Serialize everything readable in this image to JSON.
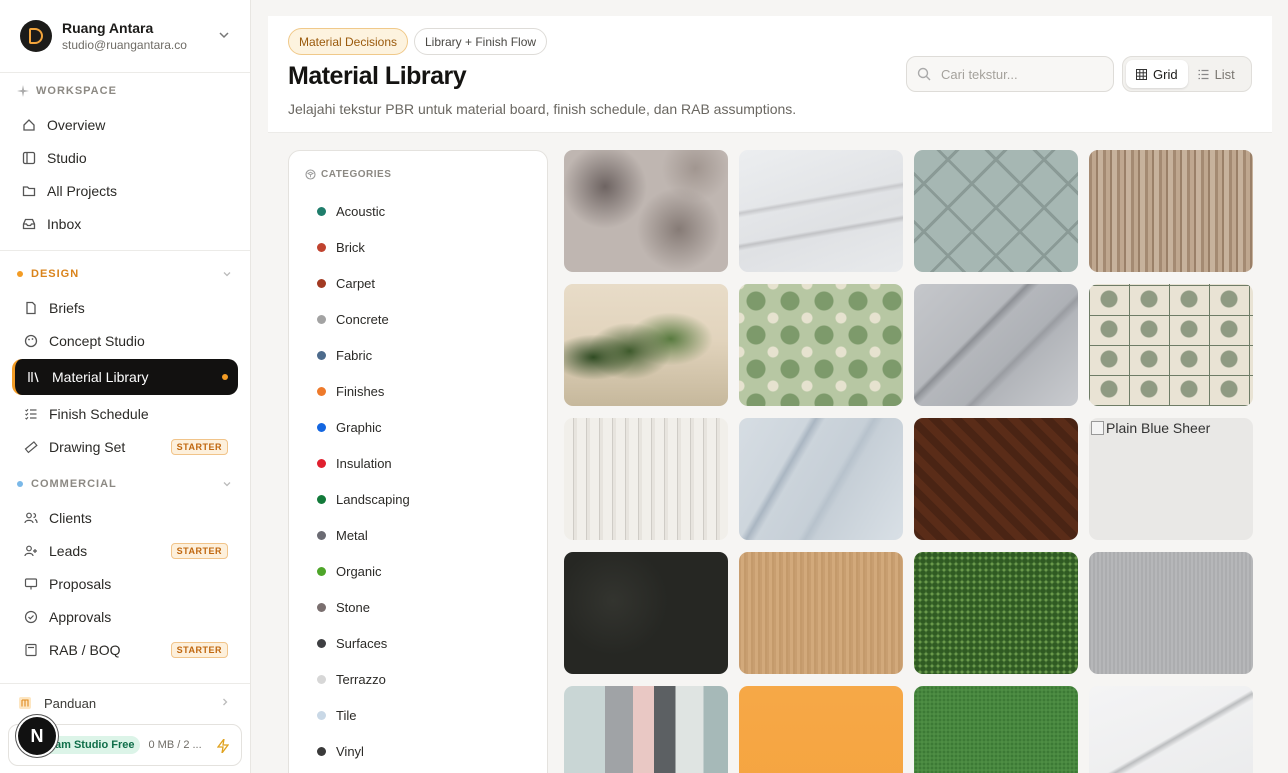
{
  "account": {
    "name": "Ruang Antara",
    "email": "studio@ruangantara.co"
  },
  "workspace": {
    "title": "WORKSPACE",
    "items": [
      {
        "label": "Overview",
        "icon": "home-icon"
      },
      {
        "label": "Studio",
        "icon": "layout-icon"
      },
      {
        "label": "All Projects",
        "icon": "folder-icon"
      },
      {
        "label": "Inbox",
        "icon": "inbox-icon"
      }
    ]
  },
  "design": {
    "title": "DESIGN",
    "accent": "#f39c25",
    "items": [
      {
        "label": "Briefs",
        "icon": "file-icon"
      },
      {
        "label": "Concept Studio",
        "icon": "palette-icon"
      },
      {
        "label": "Material Library",
        "icon": "library-icon",
        "active": true
      },
      {
        "label": "Finish Schedule",
        "icon": "checklist-icon"
      },
      {
        "label": "Drawing Set",
        "icon": "ruler-icon",
        "badge": "STARTER"
      }
    ]
  },
  "commercial": {
    "title": "COMMERCIAL",
    "accent": "#7ab8e8",
    "items": [
      {
        "label": "Clients",
        "icon": "users-icon"
      },
      {
        "label": "Leads",
        "icon": "user-plus-icon",
        "badge": "STARTER"
      },
      {
        "label": "Proposals",
        "icon": "monitor-icon"
      },
      {
        "label": "Approvals",
        "icon": "check-circle-icon"
      },
      {
        "label": "RAB / BOQ",
        "icon": "calculator-icon",
        "badge": "STARTER"
      }
    ]
  },
  "footer": {
    "guide_label": "Panduan",
    "plan_label": "Team Studio Free",
    "usage": "0 MB / 2 ...",
    "avatar_letter": "N"
  },
  "header": {
    "chip_primary": "Material Decisions",
    "chip_secondary": "Library + Finish Flow",
    "title": "Material Library",
    "subtitle": "Jelajahi tekstur PBR untuk material board, finish schedule, dan RAB assumptions.",
    "search_placeholder": "Cari tekstur...",
    "view_grid": "Grid",
    "view_list": "List",
    "active_view": "Grid"
  },
  "categories": {
    "title": "CATEGORIES",
    "items": [
      {
        "label": "Acoustic",
        "color": "#1f7d6b"
      },
      {
        "label": "Brick",
        "color": "#c0432f"
      },
      {
        "label": "Carpet",
        "color": "#a23a22"
      },
      {
        "label": "Concrete",
        "color": "#a3a3a3"
      },
      {
        "label": "Fabric",
        "color": "#4d6b8c"
      },
      {
        "label": "Finishes",
        "color": "#ee7a2b"
      },
      {
        "label": "Graphic",
        "color": "#1466e0"
      },
      {
        "label": "Insulation",
        "color": "#e0202f"
      },
      {
        "label": "Landscaping",
        "color": "#137a3a"
      },
      {
        "label": "Metal",
        "color": "#6b6b73"
      },
      {
        "label": "Organic",
        "color": "#4ea529"
      },
      {
        "label": "Stone",
        "color": "#7a6f6f"
      },
      {
        "label": "Surfaces",
        "color": "#3e3f42"
      },
      {
        "label": "Terrazzo",
        "color": "#d7d7d7"
      },
      {
        "label": "Tile",
        "color": "#c9d8e6"
      },
      {
        "label": "Vinyl",
        "color": "#3a3a3a"
      }
    ]
  },
  "materials": [
    {
      "name": "distressed-plaster-texture",
      "bg": "radial-gradient(circle at 25% 30%, #6e6462 0, transparent 28%), radial-gradient(circle at 70% 65%, #867b76 0, transparent 30%), radial-gradient(circle at 80% 15%, #a19690 0, transparent 20%), #bfb6b1"
    },
    {
      "name": "white-marble-texture",
      "bg": "linear-gradient(170deg, transparent 40%, #c8c9cc 42%, transparent 45%, transparent 62%, #c2c3c6 64%, transparent 67%), linear-gradient(160deg, #eceef0, #dfe1e4 60%, #e8eaec)"
    },
    {
      "name": "sage-herringbone-tile",
      "bg": "repeating-linear-gradient(45deg, #8a9a96 0 3px, transparent 3px 34px), repeating-linear-gradient(-45deg, #8a9a96 0 3px, transparent 3px 34px), #a6b7b3"
    },
    {
      "name": "weathered-wood-texture",
      "bg": "repeating-linear-gradient(90deg, #a48a72 0 3px, #bfa78f 3px 7px, #9a8068 7px 9px, #c7b29c 9px 14px)"
    },
    {
      "name": "tropical-palm-mural",
      "bg": "radial-gradient(ellipse at 40% 55%, #3e5a2c 0, transparent 30%), radial-gradient(ellipse at 65% 45%, #587a3f 0, transparent 28%), radial-gradient(ellipse at 18% 60%, #2e4a22 0, transparent 22%), linear-gradient(180deg, #e8dcc8 0%, #e2d4bd 45%, #c6b89c 100%)"
    },
    {
      "name": "green-moroccan-tile",
      "bg": "radial-gradient(circle, #7d9a6b 0 9px, transparent 10px) 0 0/34px 34px, radial-gradient(circle, #e6e2cf 0 5px, transparent 6px) 17px 17px/34px 34px, #b7c7a3"
    },
    {
      "name": "grey-veined-marble",
      "bg": "linear-gradient(135deg, transparent 38%, #8e9196 40%, transparent 44%, transparent 60%, #9a9da2 62%, transparent 66%), linear-gradient(135deg, #c5c7cb, #aeb1b6 60%, #c9cbcf)"
    },
    {
      "name": "toile-pattern-wallpaper",
      "bg": "repeating-linear-gradient(0deg, #6e7c66 0 1px, transparent 1px 30px), repeating-linear-gradient(90deg, #6e7c66 0 1px, transparent 1px 40px), radial-gradient(circle, #8f9a82 0 8px, transparent 9px) 0 0/40px 30px, #e9e3d4"
    },
    {
      "name": "white-fluted-tile",
      "bg": "repeating-linear-gradient(90deg, #f1efea 0 9px, #cfccc6 9px 10px, #e7e4de 10px 13px)"
    },
    {
      "name": "blue-grey-marble",
      "bg": "linear-gradient(120deg, transparent 30%, #aab6c2 33%, transparent 37%, transparent 55%, #b7c2cc 58%, transparent 62%), linear-gradient(120deg, #d6dde3, #c5ced6 60%, #d9e0e6)"
    },
    {
      "name": "dark-parquet-wood",
      "bg": "repeating-linear-gradient(45deg, #4a2414 0 8px, #5a2c18 8px 16px), #4a2414"
    },
    {
      "name": "plain-blue-sheer",
      "broken": true,
      "alt": "Plain Blue Sheer"
    },
    {
      "name": "black-stone-texture",
      "bg": "radial-gradient(circle at 30% 40%, #33342f 0, transparent 40%), #262723"
    },
    {
      "name": "light-oak-veneer",
      "bg": "repeating-linear-gradient(90deg, #c89e70 0 2px, #d2a97b 2px 5px, #c49a6b 5px 7px)"
    },
    {
      "name": "artificial-grass",
      "bg": "radial-gradient(circle, #2f5a22 0 2px, transparent 3px) 0 0/6px 6px, radial-gradient(circle, #6a9a4a 0 1px, transparent 2px) 3px 3px/6px 6px, #3f6b2f"
    },
    {
      "name": "brushed-aluminium",
      "bg": "repeating-linear-gradient(90deg, #acadaf 0 2px, #b6b7b9 2px 4px)"
    },
    {
      "name": "geometric-graphic-pattern",
      "bg": "linear-gradient(90deg, #c9d6d5 0 25%, #a0a3a6 25% 42%, #e9c8c4 42% 55%, #5c6063 55% 68%, #dfe4e2 68% 85%, #a6b9b8 85%)"
    },
    {
      "name": "orange-surface",
      "bg": "linear-gradient(#f6a847, #f5a43f)"
    },
    {
      "name": "green-turf",
      "bg": "radial-gradient(circle, #3c7a35 0 1px, transparent 2px) 0 0/4px 4px, #4f8f45"
    },
    {
      "name": "calacatta-marble",
      "bg": "linear-gradient(150deg, transparent 45%, #bcbec0 47%, transparent 50%), linear-gradient(160deg, #f4f4f5, #e9eaeb)"
    }
  ]
}
